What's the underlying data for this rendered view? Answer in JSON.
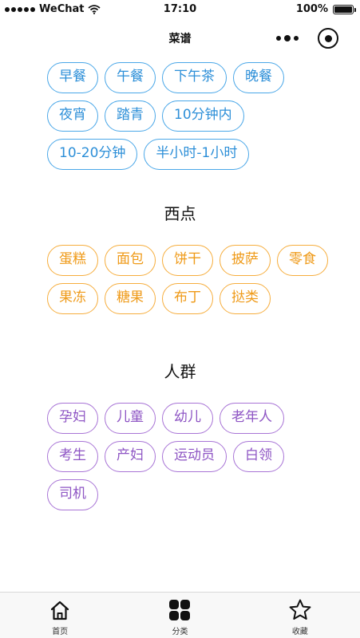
{
  "status_bar": {
    "carrier": "WeChat",
    "time": "17:10",
    "battery": "100%",
    "battery_level": 1.0
  },
  "nav": {
    "title": "菜谱"
  },
  "sections": {
    "meal": {
      "title": "",
      "tags": [
        "早餐",
        "午餐",
        "下午茶",
        "晚餐",
        "夜宵",
        "踏青",
        "10分钟内",
        "10-20分钟",
        "半小时-1小时"
      ]
    },
    "dessert": {
      "title": "西点",
      "tags": [
        "蛋糕",
        "面包",
        "饼干",
        "披萨",
        "零食",
        "果冻",
        "糖果",
        "布丁",
        "挞类"
      ]
    },
    "people": {
      "title": "人群",
      "tags": [
        "孕妇",
        "儿童",
        "幼儿",
        "老年人",
        "考生",
        "产妇",
        "运动员",
        "白领",
        "司机"
      ]
    }
  },
  "tab_bar": {
    "items": [
      {
        "label": "首页",
        "icon": "home-icon"
      },
      {
        "label": "分类",
        "icon": "category-icon"
      },
      {
        "label": "收藏",
        "icon": "star-icon"
      }
    ]
  },
  "colors": {
    "blue": "#4aa7e8",
    "orange": "#f6ad3c",
    "purple": "#a874d6"
  }
}
